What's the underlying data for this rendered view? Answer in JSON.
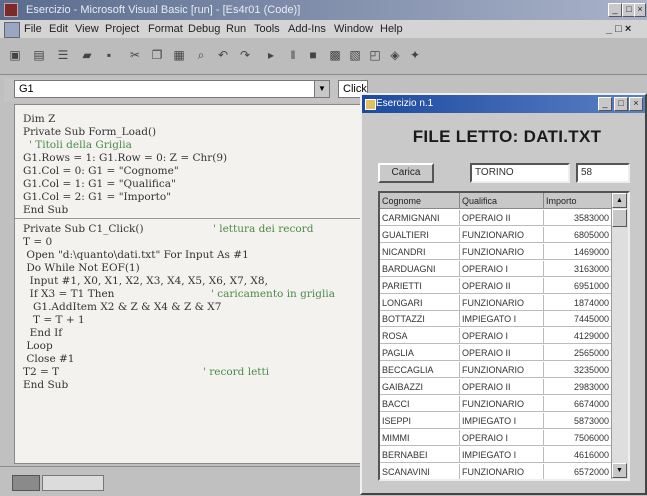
{
  "ide": {
    "title": "Esercizio - Microsoft Visual Basic [run] - [Es4r01 (Code)]",
    "menu": [
      "File",
      "Edit",
      "View",
      "Project",
      "Format",
      "Debug",
      "Run",
      "Tools",
      "Add-Ins",
      "Window",
      "Help"
    ],
    "object_combo": "G1",
    "proc_combo": "Click"
  },
  "code": {
    "lines": [
      {
        "code": "Dim Z",
        "comment": ""
      },
      {
        "code": "Private Sub Form_Load()",
        "comment": ""
      },
      {
        "code": "",
        "comment": "' Titoli della Griglia"
      },
      {
        "code": "G1.Rows = 1: G1.Row = 0: Z = Chr(9)",
        "comment": ""
      },
      {
        "code": "G1.Col = 0: G1 = \"Cognome\"",
        "comment": ""
      },
      {
        "code": "G1.Col = 1: G1 = \"Qualifica\"",
        "comment": ""
      },
      {
        "code": "G1.Col = 2: G1 = \"Importo\"",
        "comment": ""
      },
      {
        "code": "End Sub",
        "comment": ""
      },
      {
        "code": "Private Sub C1_Click()",
        "comment": "' lettura dei record"
      },
      {
        "code": "T = 0",
        "comment": ""
      },
      {
        "code": " Open \"d:\\quanto\\dati.txt\" For Input As #1",
        "comment": ""
      },
      {
        "code": " Do While Not EOF(1)",
        "comment": ""
      },
      {
        "code": "  Input #1, X0, X1, X2, X3, X4, X5, X6, X7, X8,",
        "comment": ""
      },
      {
        "code": "  If X3 = T1 Then",
        "comment": "' caricamento in griglia"
      },
      {
        "code": "   G1.AddItem X2 & Z & X4 & Z & X7",
        "comment": ""
      },
      {
        "code": "   T = T + 1",
        "comment": ""
      },
      {
        "code": "  End If",
        "comment": ""
      },
      {
        "code": " Loop",
        "comment": ""
      },
      {
        "code": " Close #1",
        "comment": ""
      },
      {
        "code": "T2 = T",
        "comment": "' record letti"
      },
      {
        "code": "End Sub",
        "comment": ""
      }
    ]
  },
  "form": {
    "title": "Esercizio n.1",
    "heading": "FILE LETTO: DATI.TXT",
    "button_label": "Carica",
    "city_value": "TORINO",
    "count_value": "58",
    "grid": {
      "headers": [
        "Cognome",
        "Qualifica",
        "Importo"
      ],
      "rows": [
        [
          "CARMIGNANI",
          "OPERAIO II",
          "3583000"
        ],
        [
          "GUALTIERI",
          "FUNZIONARIO",
          "6805000"
        ],
        [
          "NICANDRI",
          "FUNZIONARIO",
          "1469000"
        ],
        [
          "BARDUAGNI",
          "OPERAIO I",
          "3163000"
        ],
        [
          "PARIETTI",
          "OPERAIO II",
          "6951000"
        ],
        [
          "LONGARI",
          "FUNZIONARIO",
          "1874000"
        ],
        [
          "BOTTAZZI",
          "IMPIEGATO I",
          "7445000"
        ],
        [
          "ROSA",
          "OPERAIO I",
          "4129000"
        ],
        [
          "PAGLIA",
          "OPERAIO II",
          "2565000"
        ],
        [
          "BECCAGLIA",
          "FUNZIONARIO",
          "3235000"
        ],
        [
          "GAIBAZZI",
          "OPERAIO II",
          "2983000"
        ],
        [
          "BACCI",
          "FUNZIONARIO",
          "6674000"
        ],
        [
          "ISEPPI",
          "IMPIEGATO I",
          "5873000"
        ],
        [
          "MIMMI",
          "OPERAIO I",
          "7506000"
        ],
        [
          "BERNABEI",
          "IMPIEGATO I",
          "4616000"
        ],
        [
          "SCANAVINI",
          "FUNZIONARIO",
          "6572000"
        ]
      ]
    }
  },
  "colors": {
    "ide_titlebar": "#5a6c8e",
    "form_titlebar": "#1d4aa0",
    "comment": "#4a8a4a"
  }
}
